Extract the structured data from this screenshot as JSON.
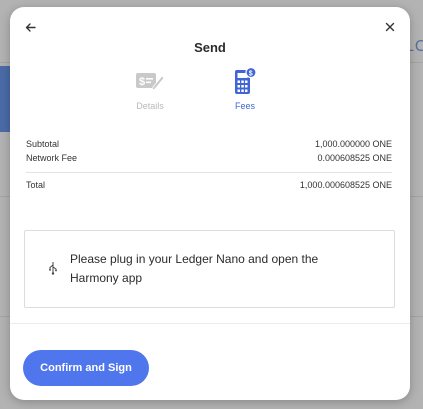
{
  "background": {
    "partial_text": "LO"
  },
  "modal": {
    "title": "Send",
    "back_icon": "arrow-left-icon",
    "close_icon": "close-icon",
    "steps": [
      {
        "label": "Details",
        "icon": "document-edit-icon",
        "state": "completed"
      },
      {
        "label": "Fees",
        "icon": "calculator-icon",
        "state": "active"
      }
    ],
    "summary": {
      "subtotal_label": "Subtotal",
      "subtotal_value": "1,000.000000 ONE",
      "fee_label": "Network Fee",
      "fee_value": "0.000608525 ONE",
      "total_label": "Total",
      "total_value": "1,000.000608525 ONE"
    },
    "device_prompt": {
      "icon": "usb-icon",
      "message": "Please plug in your Ledger Nano and open the Harmony app"
    },
    "confirm_button": "Confirm and Sign"
  },
  "colors": {
    "accent": "#4f76ec",
    "active_step": "#3f65d6",
    "inactive_step": "#b9b9b9"
  }
}
